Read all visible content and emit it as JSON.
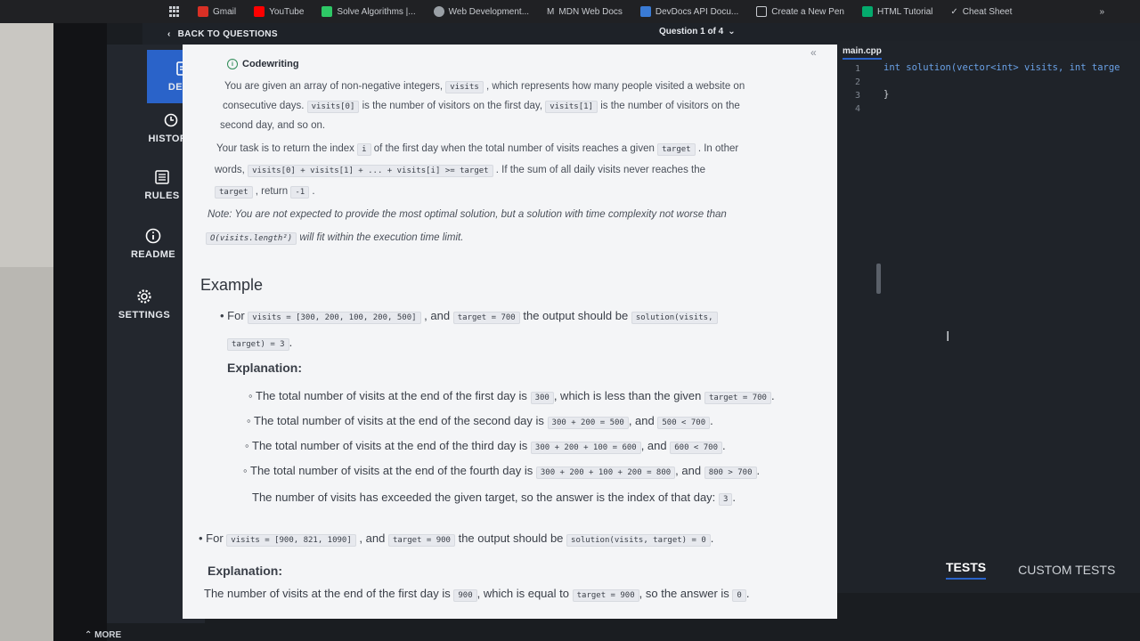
{
  "bookmarks": [
    {
      "label": "Gmail",
      "icon": "gmail-icon",
      "color": "#d93025"
    },
    {
      "label": "YouTube",
      "icon": "youtube-icon",
      "color": "#ff0000"
    },
    {
      "label": "Solve Algorithms |...",
      "icon": "hackerrank-icon",
      "color": "#2ec866"
    },
    {
      "label": "Web Development...",
      "icon": "web-icon",
      "color": "#9aa0a6"
    },
    {
      "label": "MDN Web Docs",
      "icon": "mdn-icon",
      "color": "#c8cbd0"
    },
    {
      "label": "DevDocs API Docu...",
      "icon": "devdocs-icon",
      "color": "#3a7bd5"
    },
    {
      "label": "Create a New Pen",
      "icon": "codepen-icon",
      "color": "#c8cbd0"
    },
    {
      "label": "HTML Tutorial",
      "icon": "w3-icon",
      "color": "#04aa6d"
    },
    {
      "label": "Cheat Sheet",
      "icon": "cheatsheet-icon",
      "color": "#c8cbd0"
    }
  ],
  "bookmarks_more": "»",
  "topbar": {
    "back_label": "BACK TO QUESTIONS",
    "question_selector": "Question 1 of 4"
  },
  "sidebar": {
    "items": [
      {
        "label": "DESC",
        "icon": "document-icon"
      },
      {
        "label": "HISTORY",
        "icon": "clock-icon"
      },
      {
        "label": "RULES",
        "icon": "list-icon"
      },
      {
        "label": "README",
        "icon": "info-icon"
      },
      {
        "label": "SETTINGS",
        "icon": "gear-icon"
      }
    ],
    "more_label": "MORE"
  },
  "description": {
    "type_label": "Codewriting",
    "p1_a": "You are given an array of non-negative integers,",
    "p1_code1": "visits",
    "p1_b": ", which represents how many people visited a website on",
    "p1_c": "consecutive days.",
    "p1_code2": "visits[0]",
    "p1_d": "is the number of visitors on the first day,",
    "p1_code3": "visits[1]",
    "p1_e": "is the number of visitors on the",
    "p1_f": "second day, and so on.",
    "p2_a": "Your task is to return the index",
    "p2_code1": "i",
    "p2_b": "of the first day when the total number of visits reaches a given",
    "p2_code2": "target",
    "p2_c": ". In other",
    "p2_d": "words,",
    "p2_code3": "visits[0] + visits[1] + ... + visits[i] >= target",
    "p2_e": ". If the sum of all daily visits never reaches the",
    "p2_code4": "target",
    "p2_f": ", return",
    "p2_code5": "-1",
    "p2_g": ".",
    "note_a": "Note: You are not expected to provide the most optimal solution, but a solution with time complexity not worse than",
    "note_code": "O(visits.length²)",
    "note_b": "will fit within the execution time limit.",
    "example_title": "Example",
    "ex1_for": "For",
    "ex1_code1": "visits = [300, 200, 100, 200, 500]",
    "ex1_and": ", and",
    "ex1_code2": "target = 700",
    "ex1_should": "the output should be",
    "ex1_code3": "solution(visits,",
    "ex1_code4": "target) = 3",
    "explanation_label": "Explanation:",
    "ex1_items": [
      {
        "text": "The total number of visits at the end of the first day is",
        "c1": "300",
        "mid": ", which is less than the given",
        "c2": "target = 700",
        "end": "."
      },
      {
        "text": "The total number of visits at the end of the second day is",
        "c1": "300 + 200 = 500",
        "mid": ", and",
        "c2": "500 < 700",
        "end": "."
      },
      {
        "text": "The total number of visits at the end of the third day is",
        "c1": "300 + 200 + 100 = 600",
        "mid": ", and",
        "c2": "600 < 700",
        "end": "."
      },
      {
        "text": "The total number of visits at the end of the fourth day is",
        "c1": "300 + 200 + 100 + 200 = 800",
        "mid": ", and",
        "c2": "800 > 700",
        "end": "."
      }
    ],
    "ex1_conclusion": "The number of visits has exceeded the given target, so the answer is the index of that day:",
    "ex1_conclusion_code": "3",
    "ex2_code1": "visits = [900, 821, 1090]",
    "ex2_code2": "target = 900",
    "ex2_code3": "solution(visits, target) = 0",
    "ex2_expl_a": "The number of visits at the end of the first day is",
    "ex2_expl_code1": "900",
    "ex2_expl_b": ", which is equal to",
    "ex2_expl_code2": "target = 900",
    "ex2_expl_c": ", so the answer is",
    "ex2_expl_code3": "0",
    "ex2_expl_d": "."
  },
  "editor": {
    "file_tab": "main.cpp",
    "line_numbers": [
      "1",
      "2",
      "3",
      "4"
    ],
    "code_line1": "int solution(vector<int> visits, int targe",
    "code_line3": "}"
  },
  "tests": {
    "tests_tab": "TESTS",
    "custom_tab": "CUSTOM TESTS"
  },
  "colors": {
    "accent": "#2a63c9",
    "sidebar_bg": "#23272e",
    "panel_bg": "#f4f5f7",
    "editor_bg": "#1f2329"
  }
}
